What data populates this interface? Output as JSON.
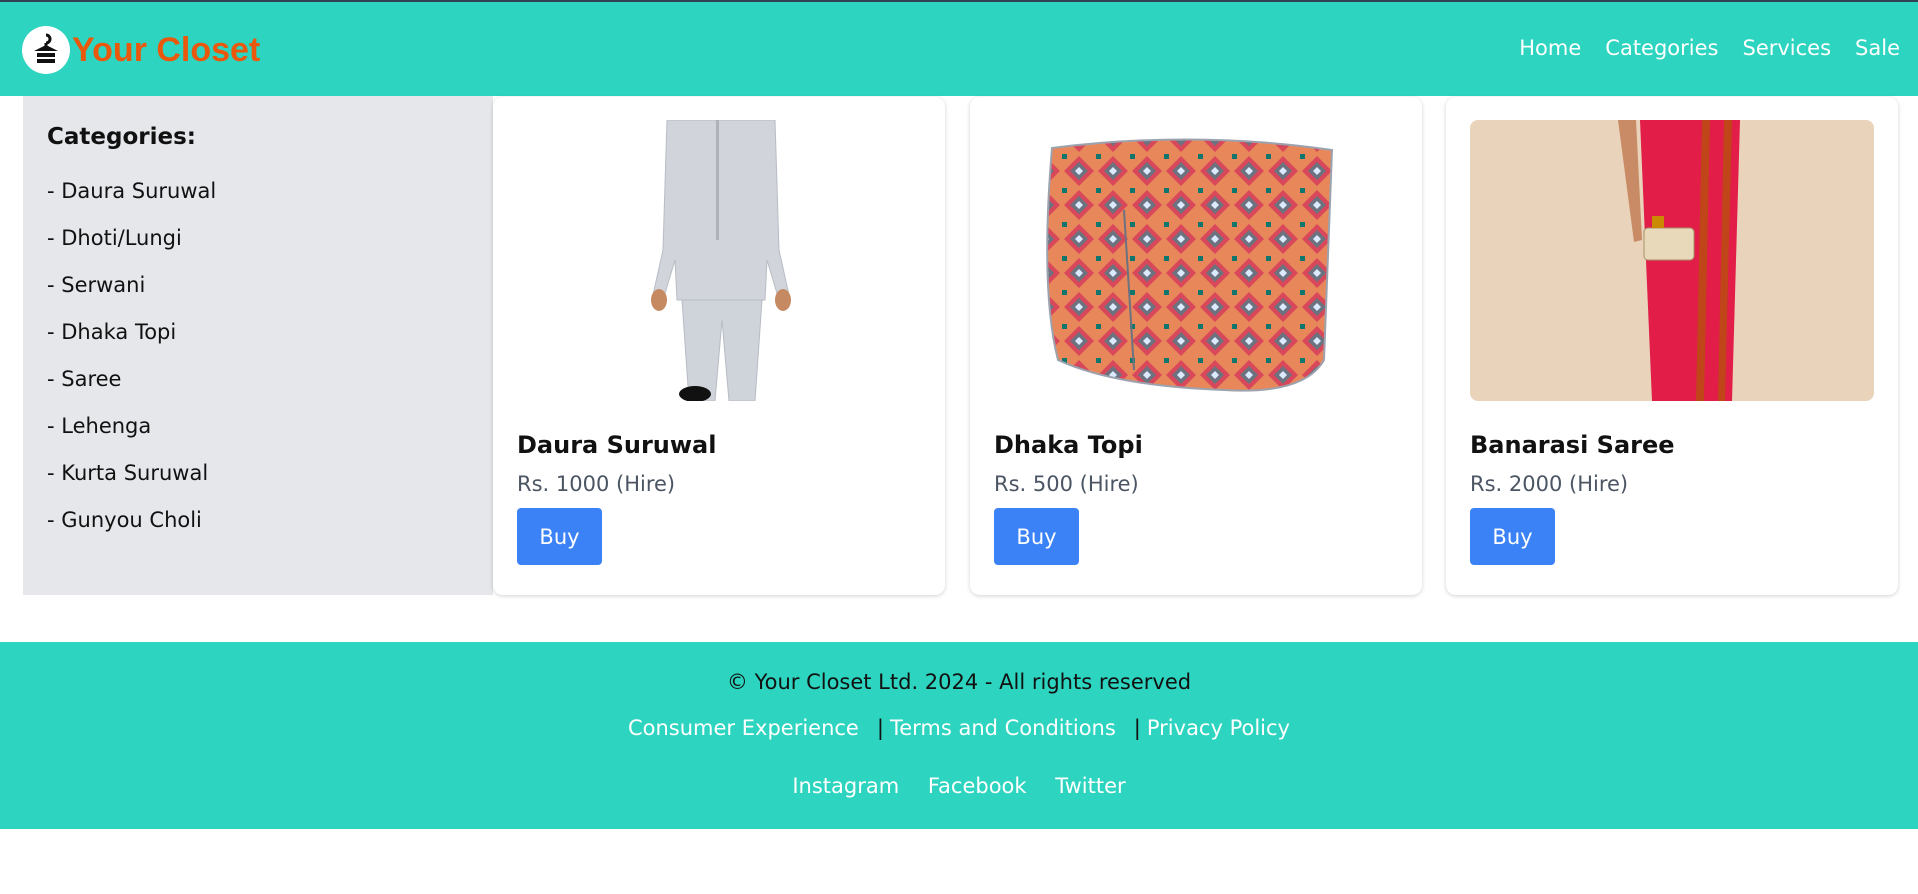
{
  "header": {
    "brand": "Your Closet",
    "nav": [
      "Home",
      "Categories",
      "Services",
      "Sale"
    ]
  },
  "sidebar": {
    "title": "Categories:",
    "items": [
      "- Daura Suruwal",
      "- Dhoti/Lungi",
      "- Serwani",
      "- Dhaka Topi",
      "- Saree",
      "- Lehenga",
      "- Kurta Suruwal",
      "- Gunyou Choli"
    ]
  },
  "products": [
    {
      "name": "Daura Suruwal",
      "price": "Rs. 1000 (Hire)",
      "button": "Buy",
      "image": "daura-suruwal-photo"
    },
    {
      "name": "Dhaka Topi",
      "price": "Rs. 500 (Hire)",
      "button": "Buy",
      "image": "dhaka-topi-photo"
    },
    {
      "name": "Banarasi Saree",
      "price": "Rs. 2000 (Hire)",
      "button": "Buy",
      "image": "banarasi-saree-photo"
    }
  ],
  "footer": {
    "copyright": "© Your Closet Ltd. 2024 - All rights reserved",
    "legal_links": [
      "Consumer Experience",
      "Terms and Conditions",
      "Privacy Policy"
    ],
    "separator": "|",
    "social_links": [
      "Instagram",
      "Facebook",
      "Twitter"
    ]
  },
  "colors": {
    "primary": "#2dd4bf",
    "brand": "#ea580c",
    "button": "#3b82f6",
    "sidebar_bg": "#e5e7eb"
  }
}
